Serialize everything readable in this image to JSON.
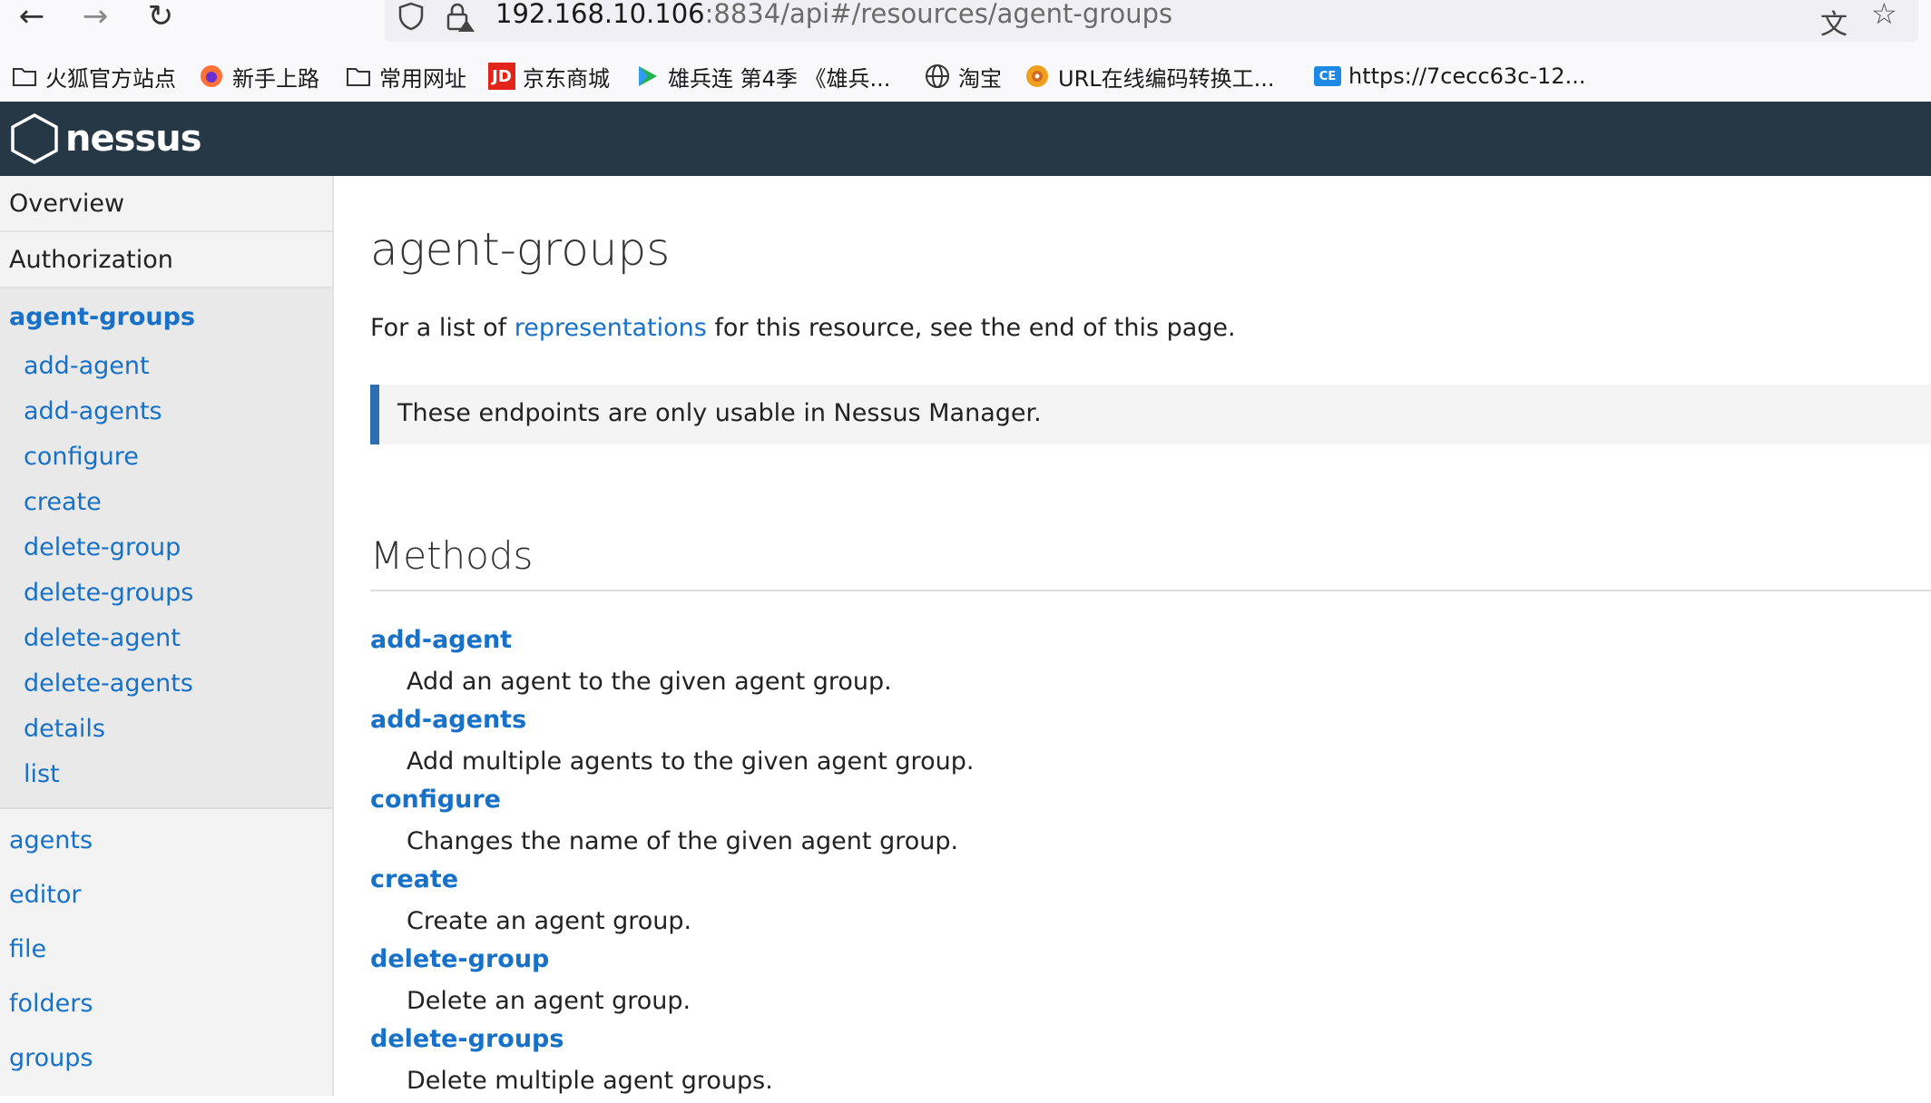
{
  "browser": {
    "url_host": "192.168.10.106",
    "url_rest": ":8834/api#/resources/agent-groups",
    "bookmarks": [
      {
        "label": "火狐官方站点",
        "icon": "folder-icon"
      },
      {
        "label": "新手上路",
        "icon": "firefox-icon"
      },
      {
        "label": "常用网址",
        "icon": "folder-icon"
      },
      {
        "label": "京东商城",
        "icon": "jd-icon",
        "icon_text": "JD"
      },
      {
        "label": "雄兵连 第4季 《雄兵...",
        "icon": "play-icon"
      },
      {
        "label": "淘宝",
        "icon": "globe-icon"
      },
      {
        "label": "URL在线编码转换工...",
        "icon": "flower-icon"
      },
      {
        "label": "https://7cecc63c-12...",
        "icon": "ce-icon",
        "icon_text": "CE"
      }
    ]
  },
  "header": {
    "logo_text": "nessus"
  },
  "sidebar": {
    "overview": "Overview",
    "authorization": "Authorization",
    "current_group": "agent-groups",
    "group_items": [
      "add-agent",
      "add-agents",
      "configure",
      "create",
      "delete-group",
      "delete-groups",
      "delete-agent",
      "delete-agents",
      "details",
      "list"
    ],
    "resources": [
      "agents",
      "editor",
      "file",
      "folders",
      "groups"
    ]
  },
  "main": {
    "title": "agent-groups",
    "intro_before": "For a list of ",
    "intro_link": "representations",
    "intro_after": " for this resource, see the end of this page.",
    "note": "These endpoints are only usable in Nessus Manager.",
    "methods_title": "Methods",
    "methods": [
      {
        "name": "add-agent",
        "desc": "Add an agent to the given agent group."
      },
      {
        "name": "add-agents",
        "desc": "Add multiple agents to the given agent group."
      },
      {
        "name": "configure",
        "desc": "Changes the name of the given agent group."
      },
      {
        "name": "create",
        "desc": "Create an agent group."
      },
      {
        "name": "delete-group",
        "desc": "Delete an agent group."
      },
      {
        "name": "delete-groups",
        "desc": "Delete multiple agent groups."
      }
    ]
  },
  "colors": {
    "header_bg": "#263746",
    "link": "#1771c8",
    "note_border": "#2e6db4"
  }
}
